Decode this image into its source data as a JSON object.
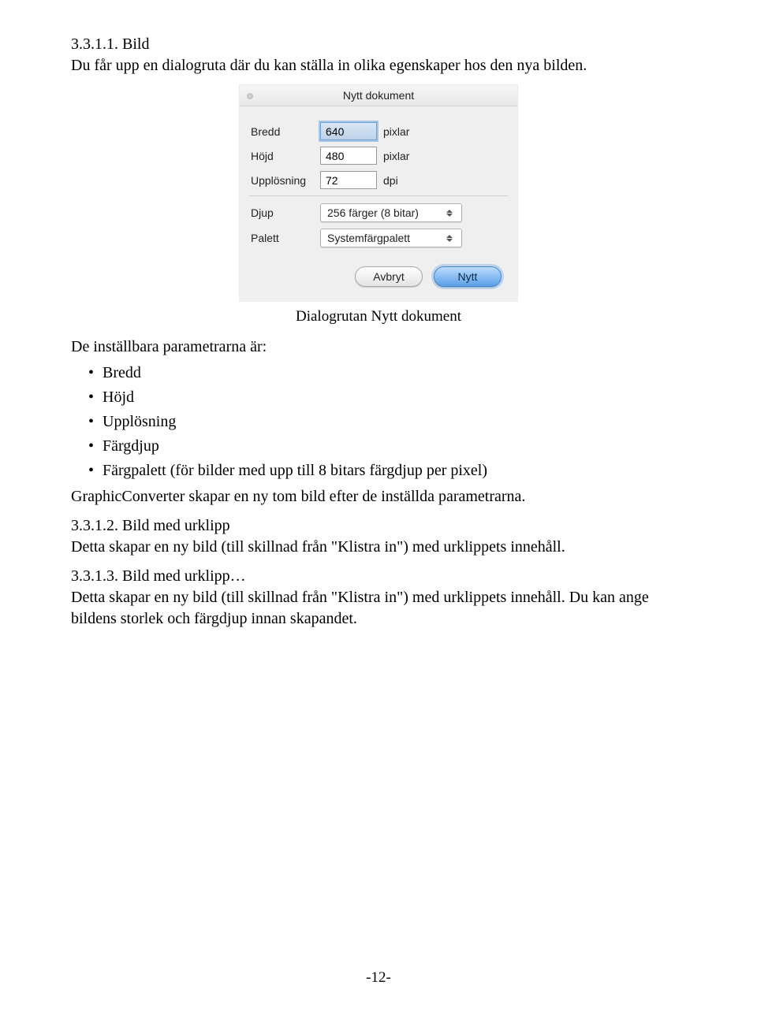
{
  "doc": {
    "sec1_heading": "3.3.1.1. Bild",
    "sec1_body": "Du får upp en dialogruta där du kan ställa in olika egenskaper hos den nya bilden.",
    "figure_caption": "Dialogrutan Nytt dokument",
    "params_intro": "De inställbara parametrarna är:",
    "bullets": {
      "b1": "Bredd",
      "b2": "Höjd",
      "b3": "Upplösning",
      "b4": "Färgdjup",
      "b5": "Färgpalett (för bilder med upp till 8 bitars färgdjup per pixel)"
    },
    "after_bullets": "GraphicConverter skapar en ny tom bild efter de inställda parametrarna.",
    "sec2_heading": "3.3.1.2. Bild med urklipp",
    "sec2_body": "Detta skapar en ny bild (till skillnad från \"Klistra in\") med urklippets innehåll.",
    "sec3_heading": "3.3.1.3. Bild med urklipp…",
    "sec3_body": "Detta skapar en ny bild (till skillnad från \"Klistra in\") med urklippets innehåll. Du kan ange bildens storlek och färgdjup innan skapandet.",
    "page_number": "-12-"
  },
  "dialog": {
    "title": "Nytt dokument",
    "labels": {
      "width": "Bredd",
      "height": "Höjd",
      "resolution": "Upplösning",
      "depth": "Djup",
      "palette": "Palett"
    },
    "values": {
      "width": "640",
      "height": "480",
      "resolution": "72"
    },
    "units": {
      "pixels": "pixlar",
      "dpi": "dpi"
    },
    "selects": {
      "depth": "256 färger (8 bitar)",
      "palette": "Systemfärgpalett"
    },
    "buttons": {
      "cancel": "Avbryt",
      "ok": "Nytt"
    }
  }
}
